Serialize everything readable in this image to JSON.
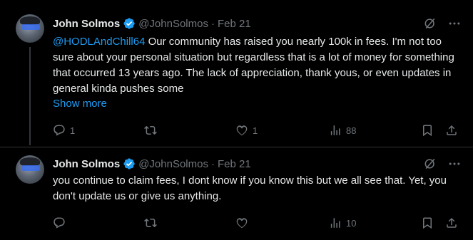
{
  "tweets": [
    {
      "author": {
        "name": "John Solmos",
        "handle": "@JohnSolmos",
        "separator": "·",
        "date": "Feb 21"
      },
      "mention": "@HODLAndChill64",
      "text": " Our community has raised you nearly 100k in fees. I'm not too sure about your personal situation but regardless that is a lot of money for something that occurred 13 years ago. The lack of appreciation, thank yous, or even updates in general kinda pushes some",
      "show_more": "Show more",
      "replies": "1",
      "reposts": "",
      "likes": "1",
      "views": "88"
    },
    {
      "author": {
        "name": "John Solmos",
        "handle": "@JohnSolmos",
        "separator": "·",
        "date": "Feb 21"
      },
      "text": "you continue to claim fees, I dont know if you know this but we all see that. Yet, you don't update us or give us anything.",
      "replies": "",
      "reposts": "",
      "likes": "",
      "views": "10"
    }
  ],
  "colors": {
    "background": "#000000",
    "text": "#e7e9ea",
    "muted": "#71767b",
    "accent": "#1d9bf0",
    "divider": "#2f3336"
  },
  "icons": [
    "verified-badge-icon",
    "grok-icon",
    "more-icon",
    "reply-icon",
    "repost-icon",
    "like-icon",
    "views-icon",
    "bookmark-icon",
    "share-icon"
  ]
}
